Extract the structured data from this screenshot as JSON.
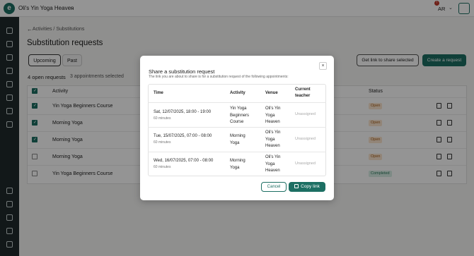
{
  "header": {
    "logo_glyph": "e",
    "studio_name": "Oli's Yin Yoga Heaven",
    "studio_chevron": "⌄",
    "language": "AR",
    "language_chevron": "⌄",
    "notification_count": "!"
  },
  "sidebar": {
    "icons": [
      "home-icon",
      "bolt-icon",
      "user-icon",
      "euro-icon",
      "chart-icon",
      "box-icon",
      "plus-circle-icon",
      "link-icon",
      "news-icon",
      "settings-icon",
      "help-icon",
      "heart-icon",
      "logout-icon"
    ]
  },
  "page": {
    "back_arrow": "←",
    "breadcrumb_parent": "Activities",
    "breadcrumb_sep": "/",
    "breadcrumb_current": "Substitutions",
    "title": "Substitution requests",
    "tabs": [
      "Upcoming",
      "Past"
    ],
    "share_button": "Get link to share selected",
    "create_button": "Create a request",
    "open_count": "4 open requests",
    "selected_count": "3 appointments selected"
  },
  "table": {
    "headers": {
      "activity": "Activity",
      "status": "Status"
    },
    "rows": [
      {
        "activity": "Yin Yoga Beginners Course",
        "status": "Open",
        "checked": true
      },
      {
        "activity": "Morning Yoga",
        "status": "Open",
        "checked": true
      },
      {
        "activity": "Morning Yoga",
        "status": "Open",
        "checked": true
      },
      {
        "activity": "Morning Yoga",
        "status": "Open",
        "checked": false
      },
      {
        "activity": "Yin Yoga Beginners Course",
        "status": "Completed",
        "checked": false
      }
    ]
  },
  "modal": {
    "title": "Share a substitution request",
    "subtitle": "The link you are about to share is for a substitution request of the following appointments:",
    "close_glyph": "×",
    "headers": {
      "time": "Time",
      "activity": "Activity",
      "venue": "Venue",
      "teacher_1": "Current",
      "teacher_2": "teacher"
    },
    "rows": [
      {
        "time": "Sat, 12/07/2025, 18:00 - 19:00",
        "duration": "60 minutes",
        "activity_1": "Yin Yoga",
        "activity_2": "Beginners",
        "activity_3": "Course",
        "venue_1": "Oli's Yin",
        "venue_2": "Yoga",
        "venue_3": "Heaven",
        "teacher": "Unassigned"
      },
      {
        "time": "Tue, 15/07/2025, 07:00 - 08:00",
        "duration": "60 minutes",
        "activity_1": "Morning",
        "activity_2": "Yoga",
        "activity_3": "",
        "venue_1": "Oli's Yin",
        "venue_2": "Yoga",
        "venue_3": "Heaven",
        "teacher": "Unassigned"
      },
      {
        "time": "Wed, 16/07/2025, 07:00 - 08:00",
        "duration": "60 minutes",
        "activity_1": "Morning",
        "activity_2": "Yoga",
        "activity_3": "",
        "venue_1": "Oli's Yin",
        "venue_2": "Yoga",
        "venue_3": "Heaven",
        "teacher": "Unassigned"
      }
    ],
    "cancel_button": "Cancel",
    "copy_button": "Copy link"
  },
  "colors": {
    "brand": "#1d6f63",
    "sidebar": "#1f2a2c",
    "open_badge": "#fbe5cf",
    "completed_badge": "#d7eee5"
  }
}
